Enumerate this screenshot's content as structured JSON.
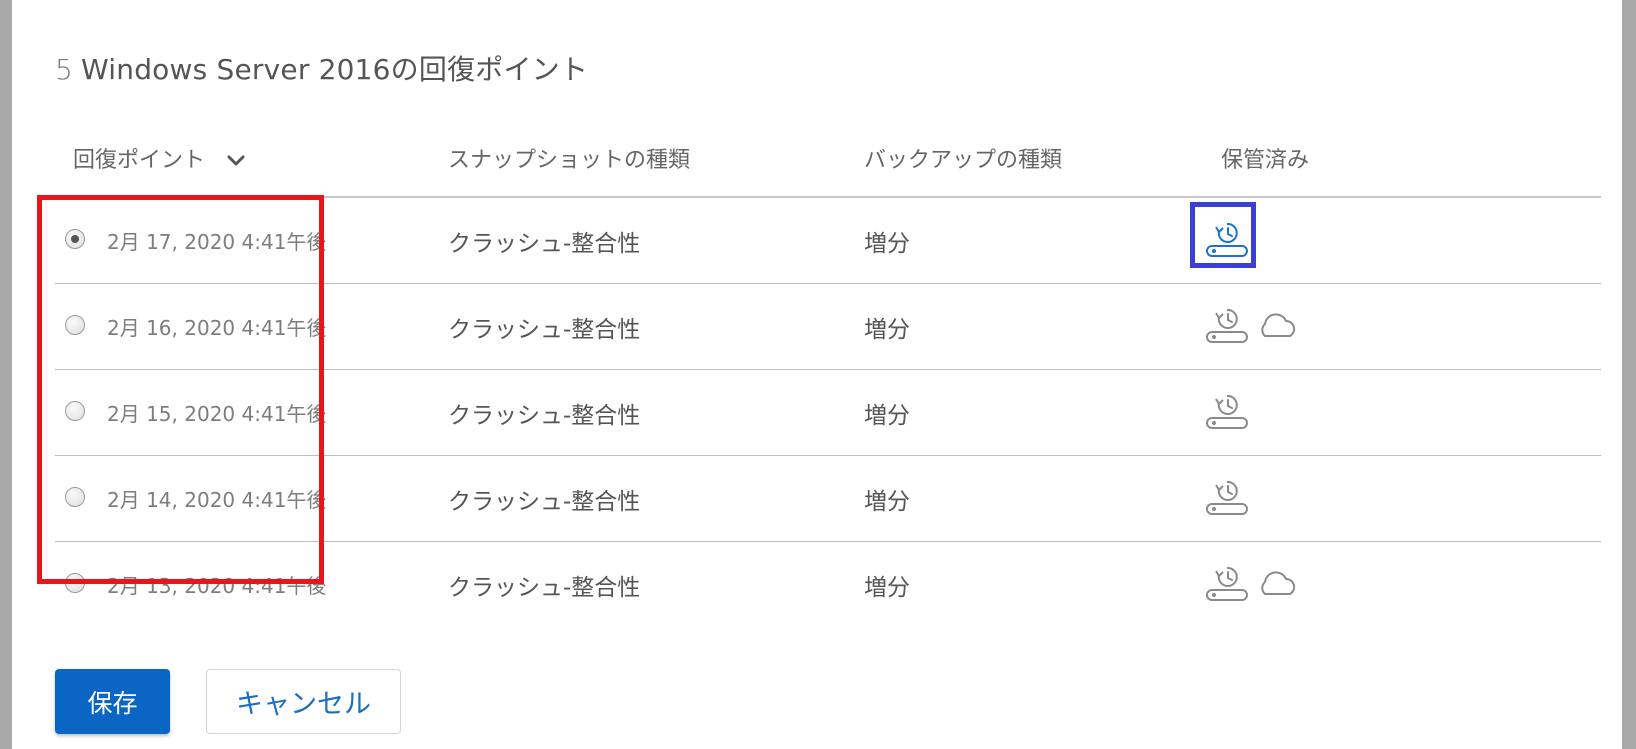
{
  "dialog": {
    "title_count": "5",
    "title_text": "Windows Server 2016の回復ポイント"
  },
  "table": {
    "headers": {
      "recovery_point": "回復ポイント",
      "snapshot_type": "スナップショットの種類",
      "backup_type": "バックアップの種類",
      "archived": "保管済み"
    },
    "rows": [
      {
        "date": "2月 17, 2020 4:41午後",
        "snapshot": "クラッシュ-整合性",
        "backup": "増分",
        "selected": true,
        "icons": [
          "local-restore-icon"
        ]
      },
      {
        "date": "2月 16, 2020 4:41午後",
        "snapshot": "クラッシュ-整合性",
        "backup": "増分",
        "selected": false,
        "icons": [
          "local-restore-icon",
          "cloud-icon"
        ]
      },
      {
        "date": "2月 15, 2020 4:41午後",
        "snapshot": "クラッシュ-整合性",
        "backup": "増分",
        "selected": false,
        "icons": [
          "local-restore-icon"
        ]
      },
      {
        "date": "2月 14, 2020 4:41午後",
        "snapshot": "クラッシュ-整合性",
        "backup": "増分",
        "selected": false,
        "icons": [
          "local-restore-icon"
        ]
      },
      {
        "date": "2月 13, 2020 4:41午後",
        "snapshot": "クラッシュ-整合性",
        "backup": "増分",
        "selected": false,
        "icons": [
          "local-restore-icon",
          "cloud-icon"
        ]
      }
    ]
  },
  "footer": {
    "save_label": "保存",
    "cancel_label": "キャンセル"
  },
  "colors": {
    "primary": "#0b66c3",
    "annotation_red": "#e8151d",
    "annotation_blue": "#3b3fd6",
    "active_icon": "#1a73d4",
    "icon_gray": "#8a8a8a"
  }
}
